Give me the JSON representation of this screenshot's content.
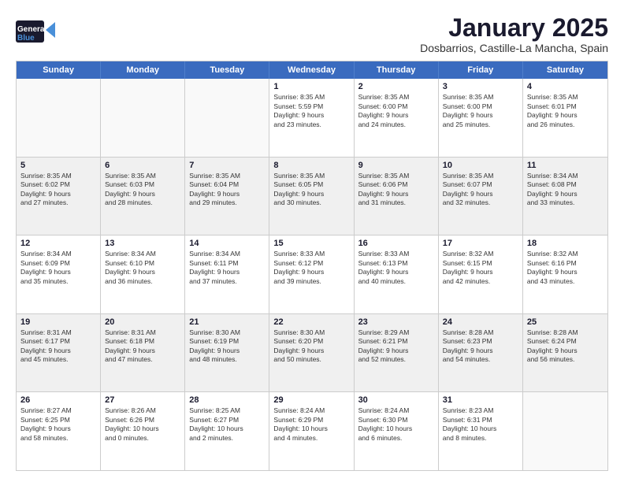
{
  "header": {
    "logo_line1": "General",
    "logo_line2": "Blue",
    "title": "January 2025",
    "subtitle": "Dosbarrios, Castille-La Mancha, Spain"
  },
  "weekdays": [
    "Sunday",
    "Monday",
    "Tuesday",
    "Wednesday",
    "Thursday",
    "Friday",
    "Saturday"
  ],
  "weeks": [
    [
      {
        "day": "",
        "text": "",
        "empty": true
      },
      {
        "day": "",
        "text": "",
        "empty": true
      },
      {
        "day": "",
        "text": "",
        "empty": true
      },
      {
        "day": "1",
        "text": "Sunrise: 8:35 AM\nSunset: 5:59 PM\nDaylight: 9 hours\nand 23 minutes.",
        "empty": false
      },
      {
        "day": "2",
        "text": "Sunrise: 8:35 AM\nSunset: 6:00 PM\nDaylight: 9 hours\nand 24 minutes.",
        "empty": false
      },
      {
        "day": "3",
        "text": "Sunrise: 8:35 AM\nSunset: 6:00 PM\nDaylight: 9 hours\nand 25 minutes.",
        "empty": false
      },
      {
        "day": "4",
        "text": "Sunrise: 8:35 AM\nSunset: 6:01 PM\nDaylight: 9 hours\nand 26 minutes.",
        "empty": false
      }
    ],
    [
      {
        "day": "5",
        "text": "Sunrise: 8:35 AM\nSunset: 6:02 PM\nDaylight: 9 hours\nand 27 minutes.",
        "empty": false
      },
      {
        "day": "6",
        "text": "Sunrise: 8:35 AM\nSunset: 6:03 PM\nDaylight: 9 hours\nand 28 minutes.",
        "empty": false
      },
      {
        "day": "7",
        "text": "Sunrise: 8:35 AM\nSunset: 6:04 PM\nDaylight: 9 hours\nand 29 minutes.",
        "empty": false
      },
      {
        "day": "8",
        "text": "Sunrise: 8:35 AM\nSunset: 6:05 PM\nDaylight: 9 hours\nand 30 minutes.",
        "empty": false
      },
      {
        "day": "9",
        "text": "Sunrise: 8:35 AM\nSunset: 6:06 PM\nDaylight: 9 hours\nand 31 minutes.",
        "empty": false
      },
      {
        "day": "10",
        "text": "Sunrise: 8:35 AM\nSunset: 6:07 PM\nDaylight: 9 hours\nand 32 minutes.",
        "empty": false
      },
      {
        "day": "11",
        "text": "Sunrise: 8:34 AM\nSunset: 6:08 PM\nDaylight: 9 hours\nand 33 minutes.",
        "empty": false
      }
    ],
    [
      {
        "day": "12",
        "text": "Sunrise: 8:34 AM\nSunset: 6:09 PM\nDaylight: 9 hours\nand 35 minutes.",
        "empty": false
      },
      {
        "day": "13",
        "text": "Sunrise: 8:34 AM\nSunset: 6:10 PM\nDaylight: 9 hours\nand 36 minutes.",
        "empty": false
      },
      {
        "day": "14",
        "text": "Sunrise: 8:34 AM\nSunset: 6:11 PM\nDaylight: 9 hours\nand 37 minutes.",
        "empty": false
      },
      {
        "day": "15",
        "text": "Sunrise: 8:33 AM\nSunset: 6:12 PM\nDaylight: 9 hours\nand 39 minutes.",
        "empty": false
      },
      {
        "day": "16",
        "text": "Sunrise: 8:33 AM\nSunset: 6:13 PM\nDaylight: 9 hours\nand 40 minutes.",
        "empty": false
      },
      {
        "day": "17",
        "text": "Sunrise: 8:32 AM\nSunset: 6:15 PM\nDaylight: 9 hours\nand 42 minutes.",
        "empty": false
      },
      {
        "day": "18",
        "text": "Sunrise: 8:32 AM\nSunset: 6:16 PM\nDaylight: 9 hours\nand 43 minutes.",
        "empty": false
      }
    ],
    [
      {
        "day": "19",
        "text": "Sunrise: 8:31 AM\nSunset: 6:17 PM\nDaylight: 9 hours\nand 45 minutes.",
        "empty": false
      },
      {
        "day": "20",
        "text": "Sunrise: 8:31 AM\nSunset: 6:18 PM\nDaylight: 9 hours\nand 47 minutes.",
        "empty": false
      },
      {
        "day": "21",
        "text": "Sunrise: 8:30 AM\nSunset: 6:19 PM\nDaylight: 9 hours\nand 48 minutes.",
        "empty": false
      },
      {
        "day": "22",
        "text": "Sunrise: 8:30 AM\nSunset: 6:20 PM\nDaylight: 9 hours\nand 50 minutes.",
        "empty": false
      },
      {
        "day": "23",
        "text": "Sunrise: 8:29 AM\nSunset: 6:21 PM\nDaylight: 9 hours\nand 52 minutes.",
        "empty": false
      },
      {
        "day": "24",
        "text": "Sunrise: 8:28 AM\nSunset: 6:23 PM\nDaylight: 9 hours\nand 54 minutes.",
        "empty": false
      },
      {
        "day": "25",
        "text": "Sunrise: 8:28 AM\nSunset: 6:24 PM\nDaylight: 9 hours\nand 56 minutes.",
        "empty": false
      }
    ],
    [
      {
        "day": "26",
        "text": "Sunrise: 8:27 AM\nSunset: 6:25 PM\nDaylight: 9 hours\nand 58 minutes.",
        "empty": false
      },
      {
        "day": "27",
        "text": "Sunrise: 8:26 AM\nSunset: 6:26 PM\nDaylight: 10 hours\nand 0 minutes.",
        "empty": false
      },
      {
        "day": "28",
        "text": "Sunrise: 8:25 AM\nSunset: 6:27 PM\nDaylight: 10 hours\nand 2 minutes.",
        "empty": false
      },
      {
        "day": "29",
        "text": "Sunrise: 8:24 AM\nSunset: 6:29 PM\nDaylight: 10 hours\nand 4 minutes.",
        "empty": false
      },
      {
        "day": "30",
        "text": "Sunrise: 8:24 AM\nSunset: 6:30 PM\nDaylight: 10 hours\nand 6 minutes.",
        "empty": false
      },
      {
        "day": "31",
        "text": "Sunrise: 8:23 AM\nSunset: 6:31 PM\nDaylight: 10 hours\nand 8 minutes.",
        "empty": false
      },
      {
        "day": "",
        "text": "",
        "empty": true
      }
    ]
  ]
}
